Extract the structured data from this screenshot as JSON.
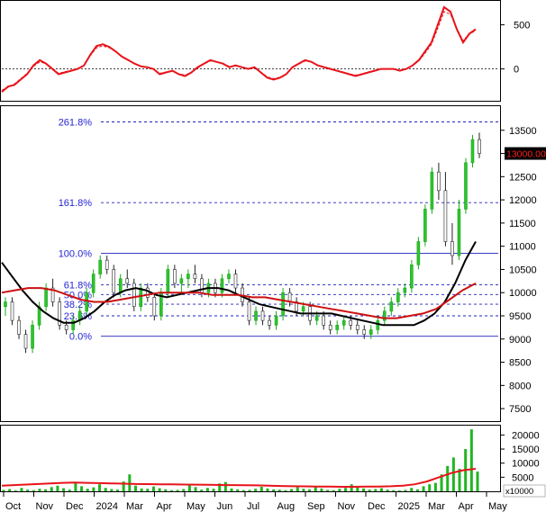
{
  "chart_data": [
    {
      "panel": "indicator",
      "type": "line",
      "yticks": [
        "500",
        "0"
      ],
      "tick_values": [
        500,
        0
      ],
      "ylim": [
        -320,
        720
      ],
      "reference_line": 0,
      "series": [
        {
          "color": "#e8141b",
          "values": [
            -260,
            -200,
            -180,
            -120,
            -60,
            40,
            100,
            60,
            0,
            -60,
            -40,
            -20,
            0,
            40,
            160,
            260,
            280,
            250,
            200,
            140,
            100,
            60,
            30,
            20,
            0,
            -60,
            -40,
            -20,
            -60,
            -80,
            -40,
            20,
            60,
            100,
            80,
            60,
            20,
            40,
            20,
            0,
            20,
            -40,
            -100,
            -120,
            -100,
            -60,
            20,
            60,
            100,
            80,
            40,
            20,
            0,
            -20,
            -40,
            -60,
            -80,
            -60,
            -40,
            -20,
            0,
            0,
            0,
            -20,
            0,
            40,
            100,
            200,
            300,
            500,
            700,
            650,
            450,
            300,
            400,
            450
          ]
        },
        {
          "color": "#e8141b",
          "dashed": true,
          "values": [
            -240,
            -210,
            -170,
            -110,
            -50,
            30,
            80,
            60,
            10,
            -50,
            -30,
            -15,
            5,
            40,
            150,
            240,
            260,
            240,
            200,
            140,
            100,
            60,
            30,
            20,
            0,
            -50,
            -35,
            -25,
            -55,
            -70,
            -40,
            10,
            55,
            90,
            80,
            60,
            30,
            35,
            20,
            5,
            15,
            -35,
            -90,
            -110,
            -95,
            -55,
            15,
            55,
            90,
            80,
            45,
            25,
            5,
            -15,
            -35,
            -55,
            -70,
            -55,
            -35,
            -15,
            0,
            0,
            0,
            -15,
            5,
            40,
            90,
            180,
            280,
            460,
            650,
            620,
            460,
            320,
            400,
            430
          ]
        }
      ]
    },
    {
      "panel": "price",
      "type": "bar",
      "yticks": [
        "13500",
        "13000",
        "12500",
        "12000",
        "11500",
        "11000",
        "10500",
        "10000",
        "9500",
        "9000",
        "8500",
        "8000",
        "7500"
      ],
      "tick_values": [
        13500,
        13000,
        12500,
        12000,
        11500,
        11000,
        10500,
        10000,
        9500,
        9000,
        8500,
        8000,
        7500
      ],
      "ylim": [
        7250,
        14000
      ],
      "last_price_label": "13000.00",
      "fib_levels": [
        {
          "label": "261.8%",
          "value": 13680,
          "style": "dashed"
        },
        {
          "label": "161.8%",
          "value": 11940,
          "style": "dashed"
        },
        {
          "label": "100.0%",
          "value": 10850,
          "style": "solid"
        },
        {
          "label": "61.8%",
          "value": 10170,
          "style": "dashed"
        },
        {
          "label": "50.0%",
          "value": 9960,
          "style": "dashed"
        },
        {
          "label": "38.2%",
          "value": 9750,
          "style": "dashed"
        },
        {
          "label": "23.6%",
          "value": 9500,
          "style": "dashed"
        },
        {
          "label": "0.0%",
          "value": 9060,
          "style": "solid"
        }
      ],
      "candles": [
        [
          9700,
          9900,
          9500,
          9800
        ],
        [
          9800,
          9900,
          9300,
          9400
        ],
        [
          9400,
          9500,
          9000,
          9100
        ],
        [
          9100,
          9200,
          8700,
          8800
        ],
        [
          8800,
          9400,
          8700,
          9300
        ],
        [
          9300,
          9800,
          9200,
          9700
        ],
        [
          9700,
          10200,
          9600,
          10100
        ],
        [
          10100,
          10300,
          9700,
          9800
        ],
        [
          9800,
          9900,
          9200,
          9300
        ],
        [
          9300,
          9400,
          9100,
          9200
        ],
        [
          9200,
          9500,
          9100,
          9400
        ],
        [
          9400,
          9700,
          9300,
          9600
        ],
        [
          9600,
          10100,
          9500,
          10000
        ],
        [
          10000,
          10500,
          9900,
          10400
        ],
        [
          10400,
          10800,
          10300,
          10700
        ],
        [
          10700,
          10800,
          10400,
          10500
        ],
        [
          10500,
          10600,
          9900,
          10000
        ],
        [
          10000,
          10400,
          9900,
          10300
        ],
        [
          10300,
          10500,
          10100,
          10200
        ],
        [
          10200,
          10300,
          9600,
          9700
        ],
        [
          9700,
          10200,
          9600,
          10100
        ],
        [
          10100,
          10200,
          9800,
          9900
        ],
        [
          9900,
          10000,
          9400,
          9500
        ],
        [
          9500,
          10100,
          9400,
          10000
        ],
        [
          10000,
          10600,
          9900,
          10500
        ],
        [
          10500,
          10600,
          10100,
          10200
        ],
        [
          10200,
          10400,
          10000,
          10300
        ],
        [
          10300,
          10500,
          10100,
          10400
        ],
        [
          10400,
          10600,
          10200,
          10300
        ],
        [
          10300,
          10400,
          9900,
          10000
        ],
        [
          10000,
          10300,
          9900,
          10200
        ],
        [
          10200,
          10300,
          9900,
          10000
        ],
        [
          10000,
          10400,
          9900,
          10300
        ],
        [
          10300,
          10500,
          10200,
          10400
        ],
        [
          10400,
          10500,
          10000,
          10100
        ],
        [
          10100,
          10200,
          9700,
          9800
        ],
        [
          9800,
          9900,
          9300,
          9400
        ],
        [
          9400,
          9700,
          9300,
          9600
        ],
        [
          9600,
          9700,
          9300,
          9400
        ],
        [
          9400,
          9500,
          9200,
          9300
        ],
        [
          9300,
          9600,
          9200,
          9500
        ],
        [
          9500,
          10100,
          9400,
          10000
        ],
        [
          10000,
          10100,
          9700,
          9800
        ],
        [
          9800,
          9900,
          9500,
          9600
        ],
        [
          9600,
          9800,
          9500,
          9700
        ],
        [
          9700,
          9800,
          9300,
          9400
        ],
        [
          9400,
          9600,
          9300,
          9500
        ],
        [
          9500,
          9600,
          9200,
          9300
        ],
        [
          9300,
          9400,
          9100,
          9200
        ],
        [
          9200,
          9400,
          9100,
          9300
        ],
        [
          9300,
          9500,
          9200,
          9400
        ],
        [
          9400,
          9500,
          9200,
          9300
        ],
        [
          9300,
          9400,
          9100,
          9200
        ],
        [
          9200,
          9300,
          9000,
          9100
        ],
        [
          9100,
          9300,
          9000,
          9200
        ],
        [
          9200,
          9500,
          9100,
          9400
        ],
        [
          9400,
          9700,
          9300,
          9600
        ],
        [
          9600,
          9900,
          9500,
          9800
        ],
        [
          9800,
          10100,
          9700,
          10000
        ],
        [
          10000,
          10200,
          9900,
          10100
        ],
        [
          10100,
          10700,
          10000,
          10600
        ],
        [
          10600,
          11200,
          10500,
          11100
        ],
        [
          11100,
          11900,
          11000,
          11800
        ],
        [
          11800,
          12700,
          11700,
          12600
        ],
        [
          12600,
          12800,
          12000,
          12200
        ],
        [
          12200,
          12600,
          11000,
          11100
        ],
        [
          11100,
          11500,
          10600,
          10800
        ],
        [
          10800,
          12000,
          10700,
          11800
        ],
        [
          11800,
          12900,
          11700,
          12800
        ],
        [
          12800,
          13400,
          12700,
          13300
        ],
        [
          13300,
          13450,
          12900,
          13000
        ]
      ],
      "series": [
        {
          "name_hidden": true,
          "color": "#000000",
          "values": [
            10650,
            10350,
            10050,
            9800,
            9600,
            9450,
            9350,
            9350,
            9450,
            9600,
            9800,
            9950,
            10050,
            10100,
            10050,
            9950,
            9900,
            9950,
            10000,
            10050,
            10100,
            10100,
            10050,
            9950,
            9850,
            9750,
            9700,
            9650,
            9600,
            9550,
            9550,
            9550,
            9550,
            9500,
            9450,
            9400,
            9350,
            9300,
            9300,
            9300,
            9300,
            9400,
            9550,
            9800,
            10200,
            10700,
            11100
          ]
        },
        {
          "name_hidden": true,
          "color": "#cc1010",
          "values": [
            10000,
            10050,
            10100,
            10100,
            10050,
            9950,
            9850,
            9800,
            9800,
            9850,
            9900,
            9950,
            10000,
            10000,
            10000,
            10000,
            9950,
            9950,
            9950,
            9900,
            9900,
            9850,
            9800,
            9750,
            9700,
            9650,
            9600,
            9550,
            9500,
            9450,
            9450,
            9500,
            9550,
            9650,
            9850,
            10050,
            10200
          ]
        }
      ]
    },
    {
      "panel": "volume",
      "type": "bar",
      "yticks": [
        "20000",
        "15000",
        "10000",
        "5000"
      ],
      "tick_values": [
        20000,
        15000,
        10000,
        5000
      ],
      "unit_label": "x10000",
      "ylim": [
        0,
        23000
      ],
      "values": [
        500,
        800,
        300,
        1200,
        600,
        400,
        900,
        700,
        1500,
        2000,
        1100,
        600,
        3000,
        1800,
        900,
        1400,
        2500,
        1200,
        800,
        600,
        3500,
        6000,
        2000,
        1000,
        900,
        1700,
        1100,
        700,
        400,
        500,
        800,
        2200,
        1500,
        600,
        1200,
        900,
        2800,
        3300,
        1000,
        700,
        400,
        500,
        900,
        1600,
        1000,
        700,
        600,
        400,
        800,
        1500,
        900,
        700,
        1700,
        1000,
        500,
        400,
        900,
        1200,
        2500,
        1900,
        1000,
        600,
        800,
        1100,
        600,
        400,
        300,
        500,
        1200,
        700,
        1800,
        2500,
        3000,
        6000,
        9000,
        12000,
        8000,
        15000,
        22000,
        7000
      ],
      "ma": [
        2000,
        2200,
        2400,
        2600,
        2800,
        3000,
        3100,
        3000,
        2900,
        2800,
        2700,
        2600,
        2550,
        2500,
        2450,
        2400,
        2350,
        2300,
        2250,
        2200,
        2150,
        2100,
        2000,
        1900,
        1800,
        1750,
        1700,
        1650,
        1600,
        1600,
        1650,
        1700,
        1800,
        2000,
        2500,
        3500,
        5000,
        6500,
        7500,
        8000
      ],
      "ma_color": "#e8141b"
    }
  ],
  "x_axis": {
    "labels": [
      "Oct",
      "Nov",
      "Dec",
      "2024",
      "Mar",
      "Apr",
      "May",
      "Jun",
      "Jul",
      "Aug",
      "Sep",
      "Nov",
      "Dec",
      "2025",
      "Mar",
      "Apr",
      "May"
    ]
  }
}
